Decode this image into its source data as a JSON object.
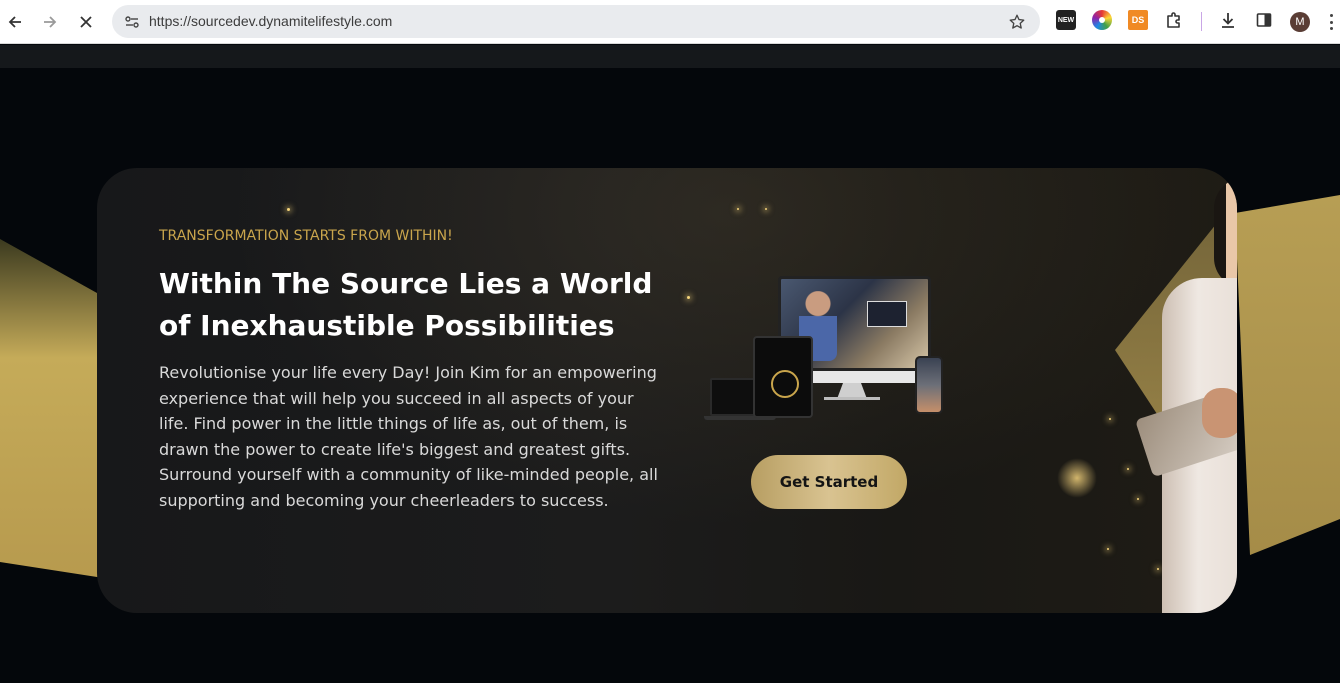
{
  "browser": {
    "url": "https://sourcedev.dynamitelifestyle.com",
    "extensions": {
      "new_badge": "NEW",
      "ds_badge": "DS"
    },
    "profile_initial": "M"
  },
  "hero": {
    "eyebrow": "TRANSFORMATION STARTS FROM WITHIN!",
    "headline": "Within The Source Lies a World of Inexhaustible Possibilities",
    "body": "Revolutionise your life every Day! Join Kim for an empowering experience that will help you succeed in all aspects of your life. Find power in the little things of life as, out of them, is drawn the power to create life's biggest and greatest gifts. Surround yourself with a community of like-minded people, all supporting and becoming your cheerleaders to success.",
    "cta_label": "Get Started"
  },
  "colors": {
    "accent_gold": "#c9a54c",
    "cta_gold": "#d9c391",
    "background": "#04070b",
    "card": "#1c1c1c"
  },
  "icons": [
    "back-arrow-icon",
    "forward-arrow-icon",
    "stop-loading-icon",
    "site-info-icon",
    "bookmark-star-icon",
    "downloads-icon",
    "side-panel-icon",
    "extensions-puzzle-icon",
    "menu-dots-icon"
  ]
}
